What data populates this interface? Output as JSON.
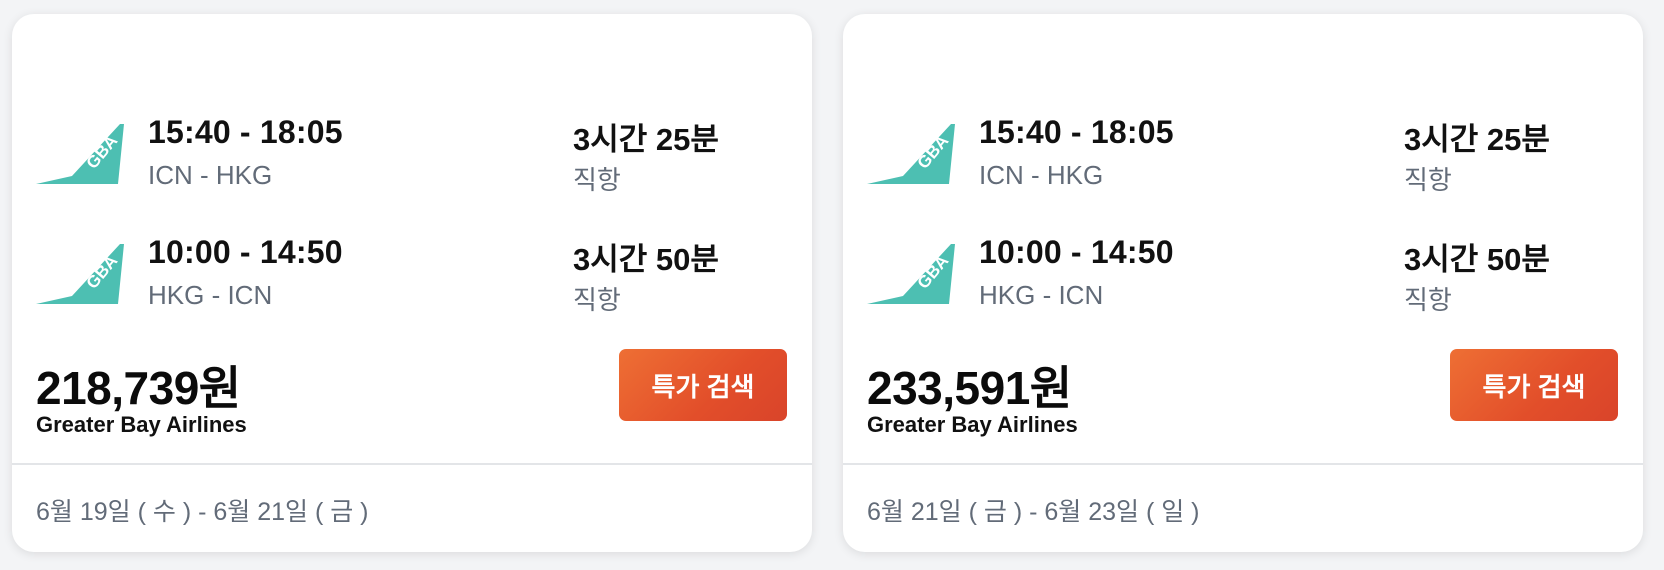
{
  "cards": [
    {
      "legs": [
        {
          "airline_logo": "GBA",
          "times": "15:40 - 18:05",
          "route": "ICN - HKG",
          "duration": "3시간 25분",
          "stops": "직항"
        },
        {
          "airline_logo": "GBA",
          "times": "10:00 - 14:50",
          "route": "HKG - ICN",
          "duration": "3시간 50분",
          "stops": "직항"
        }
      ],
      "price": "218,739원",
      "airline": "Greater Bay Airlines",
      "button_label": "특가 검색",
      "dates": "6월 19일 ( 수 ) - 6월 21일 ( 금 )"
    },
    {
      "legs": [
        {
          "airline_logo": "GBA",
          "times": "15:40 - 18:05",
          "route": "ICN - HKG",
          "duration": "3시간 25분",
          "stops": "직항"
        },
        {
          "airline_logo": "GBA",
          "times": "10:00 - 14:50",
          "route": "HKG - ICN",
          "duration": "3시간 50분",
          "stops": "직항"
        }
      ],
      "price": "233,591원",
      "airline": "Greater Bay Airlines",
      "button_label": "특가 검색",
      "dates": "6월 21일 ( 금 ) - 6월 23일 ( 일 )"
    }
  ],
  "colors": {
    "logo_teal": "#4dbfb2",
    "button_orange": "#e9582d",
    "muted_text": "#626b78"
  },
  "icons": {
    "airline_logo": "airline-tail-logo-icon"
  }
}
